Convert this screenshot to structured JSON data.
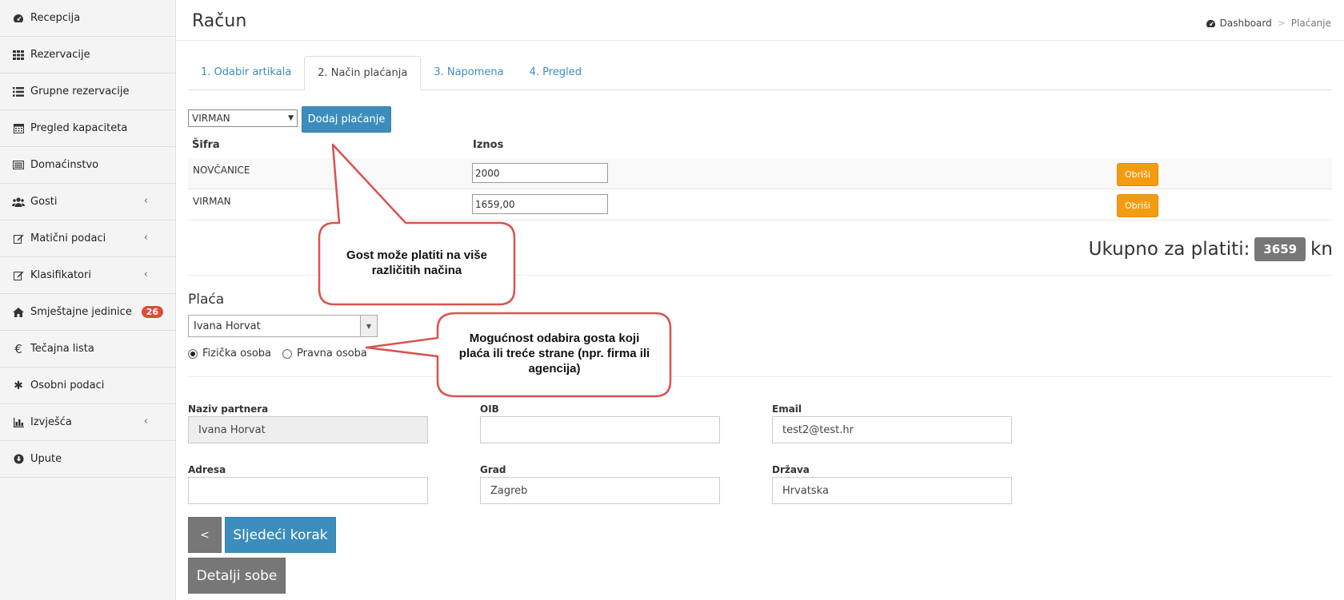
{
  "sidebar": {
    "items": [
      {
        "label": "Recepcija",
        "icon": "dashboard-icon"
      },
      {
        "label": "Rezervacije",
        "icon": "grid-icon"
      },
      {
        "label": "Grupne rezervacije",
        "icon": "list-icon"
      },
      {
        "label": "Pregled kapaciteta",
        "icon": "calendar-icon"
      },
      {
        "label": "Domaćinstvo",
        "icon": "card-icon"
      },
      {
        "label": "Gosti",
        "icon": "users-icon"
      },
      {
        "label": "Matični podaci",
        "icon": "edit-icon"
      },
      {
        "label": "Klasifikatori",
        "icon": "edit-icon"
      },
      {
        "label": "Smještajne jedinice",
        "icon": "home-icon",
        "badge": "26"
      },
      {
        "label": "Tečajna lista",
        "icon": "euro-icon"
      },
      {
        "label": "Osobni podaci",
        "icon": "asterisk-icon"
      },
      {
        "label": "Izvješća",
        "icon": "bar-chart-icon"
      },
      {
        "label": "Upute",
        "icon": "download-circle-icon"
      }
    ]
  },
  "header": {
    "title": "Račun",
    "breadcrumb": {
      "home": "Dashboard",
      "current": "Plaćanje"
    }
  },
  "tabs": [
    {
      "label": "1. Odabir artikala"
    },
    {
      "label": "2. Način plaćanja"
    },
    {
      "label": "3. Napomena"
    },
    {
      "label": "4. Pregled"
    }
  ],
  "payment": {
    "method_selected": "VIRMAN",
    "add_label": "Dodaj plaćanje",
    "columns": {
      "code": "Šifra",
      "amount": "Iznos"
    },
    "rows": [
      {
        "code": "NOVČANICE",
        "amount": "2000",
        "delete_label": "Obriši"
      },
      {
        "code": "VIRMAN",
        "amount": "1659,00",
        "delete_label": "Obriši"
      }
    ],
    "total_label": "Ukupno za platiti:",
    "total_value": "3659",
    "currency": "kn"
  },
  "payer": {
    "section_label": "Plaća",
    "guest_selected": "Ivana Horvat",
    "radio_physical": "Fizička osoba",
    "radio_legal": "Pravna osoba"
  },
  "partner": {
    "name_label": "Naziv partnera",
    "name_value": "Ivana Horvat",
    "oib_label": "OIB",
    "oib_value": "",
    "email_label": "Email",
    "email_value": "test2@test.hr",
    "address_label": "Adresa",
    "address_value": "",
    "city_label": "Grad",
    "city_value": "Zagreb",
    "country_label": "Država",
    "country_value": "Hrvatska"
  },
  "buttons": {
    "back": "<",
    "next": "Sljedeći korak",
    "room_details": "Detalji sobe"
  },
  "callouts": [
    {
      "text": "Gost može platiti na više različitih načina"
    },
    {
      "text": "Mogućnost odabira gosta koji plaća ili treće strane (npr. firma ili agencija)"
    }
  ],
  "colors": {
    "primary": "#3c8dbc",
    "warning": "#f39c12",
    "danger": "#dd4b39",
    "callout_border": "#d9534f"
  }
}
